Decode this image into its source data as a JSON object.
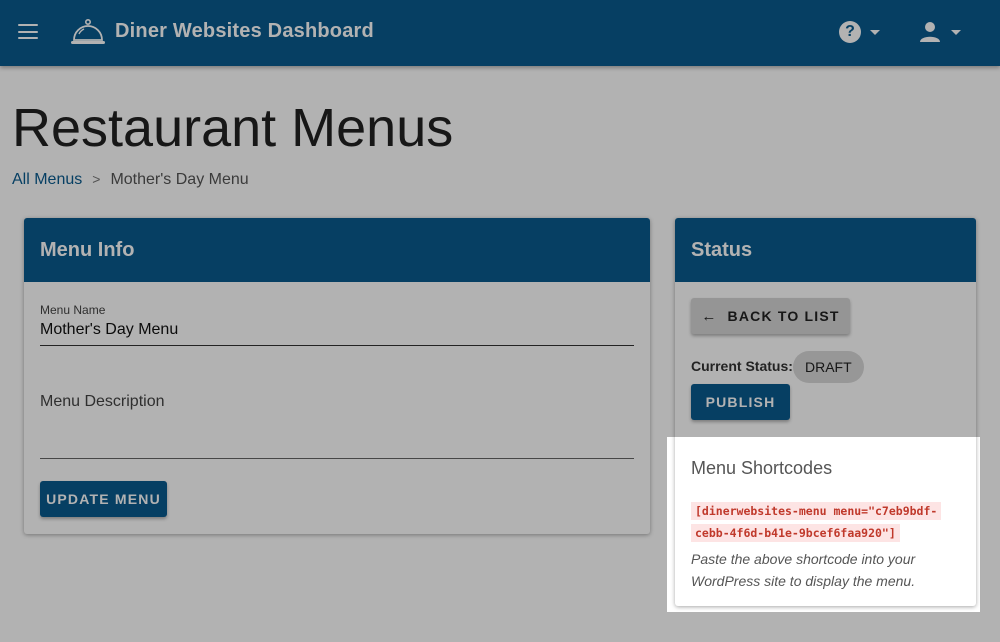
{
  "app": {
    "title": "Diner Websites Dashboard"
  },
  "icons": {
    "menu": "hamburger-icon",
    "logo": "cloche-icon",
    "help": "help-circle-icon",
    "account": "account-icon",
    "dropdown": "caret-down-icon",
    "back": "arrow-left-icon"
  },
  "page": {
    "title": "Restaurant Menus"
  },
  "breadcrumb": {
    "root": "All Menus",
    "separator": ">",
    "current": "Mother's Day Menu"
  },
  "menu_info": {
    "header": "Menu Info",
    "name_label": "Menu Name",
    "name_value": "Mother's Day Menu",
    "description_label": "Menu Description",
    "update_button": "UPDATE MENU"
  },
  "status": {
    "header": "Status",
    "back_button": "BACK TO LIST",
    "current_label": "Current Status:",
    "current_value": "DRAFT",
    "publish_button": "PUBLISH",
    "shortcodes_title": "Menu Shortcodes",
    "shortcode": "[dinerwebsites-menu menu=\"c7eb9bdf-cebb-4f6d-b41e-9bcef6faa920\"]",
    "shortcode_help": "Paste the above shortcode into your WordPress site to display the menu."
  },
  "colors": {
    "primary": "#0a5b8f",
    "code": "#c0392b",
    "code_bg": "#fde4e4"
  }
}
